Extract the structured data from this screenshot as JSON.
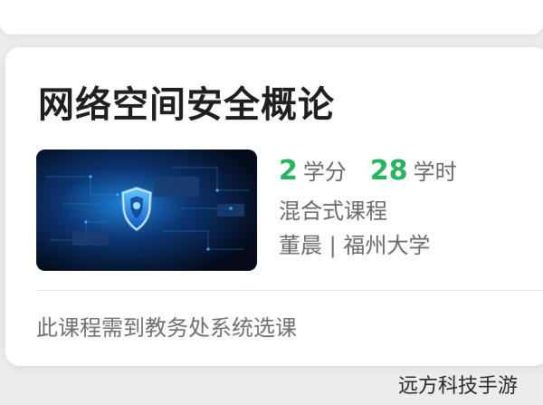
{
  "course": {
    "title": "网络空间安全概论",
    "credits": "2",
    "credits_unit": "学分",
    "hours": "28",
    "hours_unit": "学时",
    "type": "混合式课程",
    "teacher_school": "董晨 | 福州大学",
    "enroll_note": "此课程需到教务处系统选课"
  },
  "thumbnail": {
    "icon": "shield-icon"
  },
  "watermark": "远方科技手游",
  "colors": {
    "accent": "#27b35f",
    "title_text": "#1f1f1f",
    "secondary_text": "#6a6a6a"
  }
}
